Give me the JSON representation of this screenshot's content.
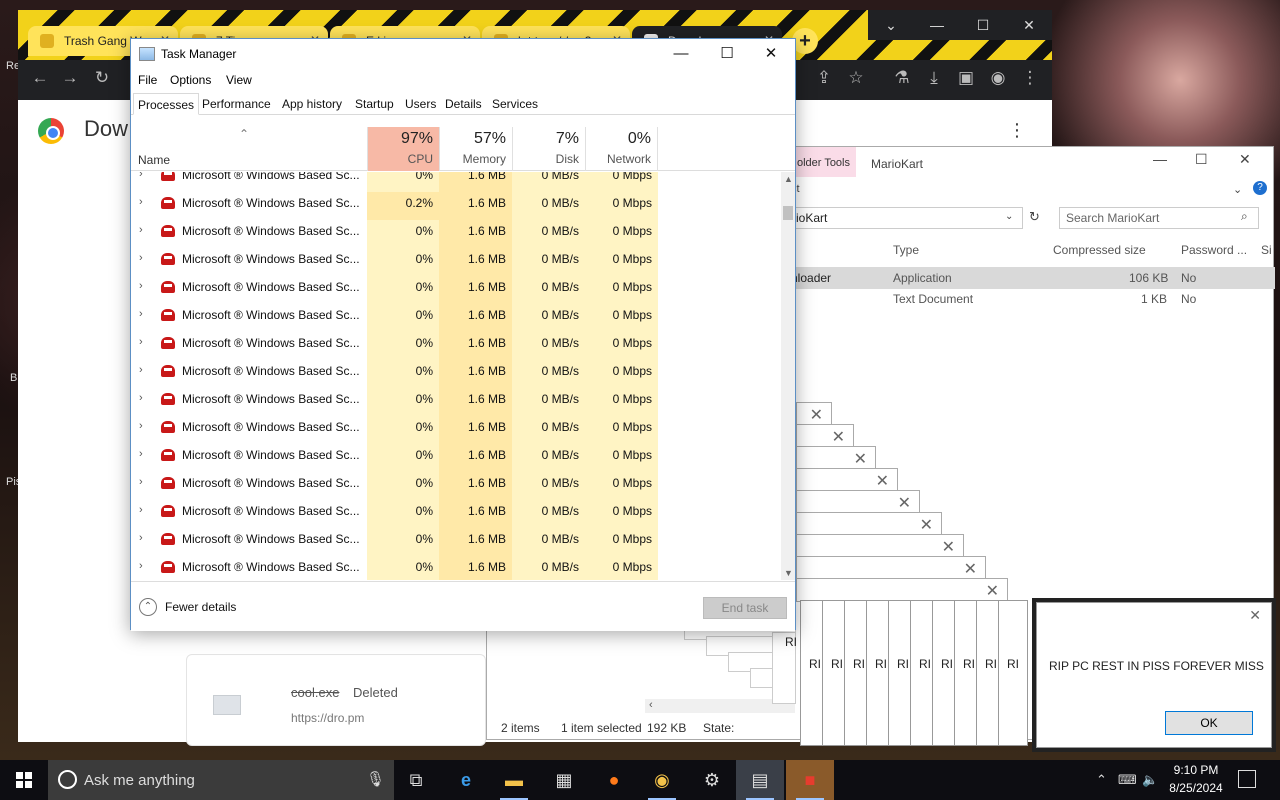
{
  "desktop": {
    "left_text_1": "Re",
    "left_text_2": "B",
    "left_text_3": "Pis"
  },
  "chrome": {
    "tabs": [
      {
        "label": "Trash Gang W"
      },
      {
        "label": "7 Ti"
      },
      {
        "label": "E l i"
      },
      {
        "label": "h t t p : / / . . 3"
      },
      {
        "label": "Downl"
      }
    ],
    "new_tab": "+",
    "page_title": "Dow",
    "menu_icon": "more-vert-icon",
    "download": {
      "file_name": "cool.exe",
      "status": "Deleted",
      "url": "https://dro.pm"
    }
  },
  "explorer": {
    "ribbon_tab": "older Tools",
    "title": "MarioKart",
    "ribbon_row": "ct",
    "address": "rioKart",
    "search_placeholder": "Search MarioKart",
    "columns": {
      "type": "Type",
      "compressed": "Compressed size",
      "password": "Password ...",
      "size": "Si"
    },
    "rows": [
      {
        "name": "nloader",
        "type": "Application",
        "compressed": "106 KB",
        "password": "No"
      },
      {
        "name": "",
        "type": "Text Document",
        "compressed": "1 KB",
        "password": "No"
      }
    ],
    "status": {
      "items": "2 items",
      "selected": "1 item selected",
      "size": "192 KB",
      "state": "State:"
    }
  },
  "error_tiles": [
    "RI",
    "RI",
    "RI",
    "RI",
    "RI",
    "RI",
    "RI",
    "RI",
    "RI",
    "RI",
    "RI"
  ],
  "popup": {
    "message": "RIP PC REST IN PISS FOREVER MISS",
    "ok": "OK"
  },
  "task_manager": {
    "title": "Task Manager",
    "menu": [
      "File",
      "Options",
      "View"
    ],
    "tabs": [
      "Processes",
      "Performance",
      "App history",
      "Startup",
      "Users",
      "Details",
      "Services"
    ],
    "name_header": "Name",
    "columns": [
      {
        "pct": "97%",
        "label": "CPU"
      },
      {
        "pct": "57%",
        "label": "Memory"
      },
      {
        "pct": "7%",
        "label": "Disk"
      },
      {
        "pct": "0%",
        "label": "Network"
      }
    ],
    "rows": [
      {
        "name": "Microsoft ® Windows Based Sc...",
        "cpu": "0%",
        "mem": "1.6 MB",
        "disk": "0 MB/s",
        "net": "0 Mbps"
      },
      {
        "name": "Microsoft ® Windows Based Sc...",
        "cpu": "0.2%",
        "mem": "1.6 MB",
        "disk": "0 MB/s",
        "net": "0 Mbps"
      },
      {
        "name": "Microsoft ® Windows Based Sc...",
        "cpu": "0%",
        "mem": "1.6 MB",
        "disk": "0 MB/s",
        "net": "0 Mbps"
      },
      {
        "name": "Microsoft ® Windows Based Sc...",
        "cpu": "0%",
        "mem": "1.6 MB",
        "disk": "0 MB/s",
        "net": "0 Mbps"
      },
      {
        "name": "Microsoft ® Windows Based Sc...",
        "cpu": "0%",
        "mem": "1.6 MB",
        "disk": "0 MB/s",
        "net": "0 Mbps"
      },
      {
        "name": "Microsoft ® Windows Based Sc...",
        "cpu": "0%",
        "mem": "1.6 MB",
        "disk": "0 MB/s",
        "net": "0 Mbps"
      },
      {
        "name": "Microsoft ® Windows Based Sc...",
        "cpu": "0%",
        "mem": "1.6 MB",
        "disk": "0 MB/s",
        "net": "0 Mbps"
      },
      {
        "name": "Microsoft ® Windows Based Sc...",
        "cpu": "0%",
        "mem": "1.6 MB",
        "disk": "0 MB/s",
        "net": "0 Mbps"
      },
      {
        "name": "Microsoft ® Windows Based Sc...",
        "cpu": "0%",
        "mem": "1.6 MB",
        "disk": "0 MB/s",
        "net": "0 Mbps"
      },
      {
        "name": "Microsoft ® Windows Based Sc...",
        "cpu": "0%",
        "mem": "1.6 MB",
        "disk": "0 MB/s",
        "net": "0 Mbps"
      },
      {
        "name": "Microsoft ® Windows Based Sc...",
        "cpu": "0%",
        "mem": "1.6 MB",
        "disk": "0 MB/s",
        "net": "0 Mbps"
      },
      {
        "name": "Microsoft ® Windows Based Sc...",
        "cpu": "0%",
        "mem": "1.6 MB",
        "disk": "0 MB/s",
        "net": "0 Mbps"
      },
      {
        "name": "Microsoft ® Windows Based Sc...",
        "cpu": "0%",
        "mem": "1.6 MB",
        "disk": "0 MB/s",
        "net": "0 Mbps"
      },
      {
        "name": "Microsoft ® Windows Based Sc...",
        "cpu": "0%",
        "mem": "1.6 MB",
        "disk": "0 MB/s",
        "net": "0 Mbps"
      },
      {
        "name": "Microsoft ® Windows Based Sc...",
        "cpu": "0%",
        "mem": "1.6 MB",
        "disk": "0 MB/s",
        "net": "0 Mbps"
      }
    ],
    "fewer_details": "Fewer details",
    "end_task": "End task"
  },
  "taskbar": {
    "search_placeholder": "Ask me anything",
    "clock_time": "9:10 PM",
    "clock_date": "8/25/2024",
    "icons": [
      "task-view-icon",
      "edge-icon",
      "file-explorer-icon",
      "store-icon",
      "firefox-icon",
      "chrome-icon",
      "settings-icon",
      "task-manager-icon",
      "mario-kart-icon"
    ]
  }
}
